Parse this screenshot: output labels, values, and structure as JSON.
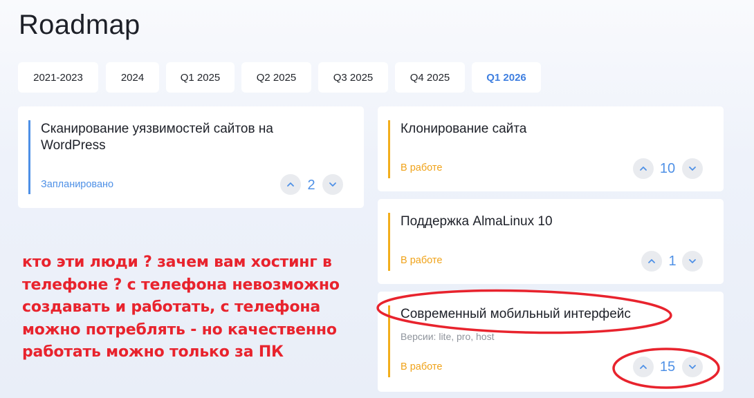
{
  "page": {
    "title": "Roadmap"
  },
  "tabs": [
    {
      "label": "2021-2023",
      "active": false
    },
    {
      "label": "2024",
      "active": false
    },
    {
      "label": "Q1 2025",
      "active": false
    },
    {
      "label": "Q2 2025",
      "active": false
    },
    {
      "label": "Q3 2025",
      "active": false
    },
    {
      "label": "Q4 2025",
      "active": false
    },
    {
      "label": "Q1 2026",
      "active": true
    }
  ],
  "cards": [
    {
      "title": "Сканирование уязвимостей сайтов на WordPress",
      "status": "Запланировано",
      "status_color": "#4e90e6",
      "votes": "2"
    },
    {
      "title": "Клонирование сайта",
      "status": "В работе",
      "status_color": "#f0a31a",
      "votes": "10"
    },
    {
      "title": "Поддержка AlmaLinux 10",
      "status": "В работе",
      "status_color": "#f0a31a",
      "votes": "1"
    },
    {
      "title": "Современный мобильный интерфейс",
      "subtitle": "Версии: lite, pro, host",
      "status": "В работе",
      "status_color": "#f0a31a",
      "votes": "15"
    }
  ],
  "annotation": {
    "text": "кто эти люди ? зачем вам хостинг в телефоне ? с телефона невозможно создавать и работать, с телефона можно потреблять - но качественно работать можно только за ПК",
    "color": "#e8232d"
  },
  "colors": {
    "accent": "#4e90e6",
    "in_progress": "#f0a31a",
    "annotation_red": "#e8232d"
  }
}
